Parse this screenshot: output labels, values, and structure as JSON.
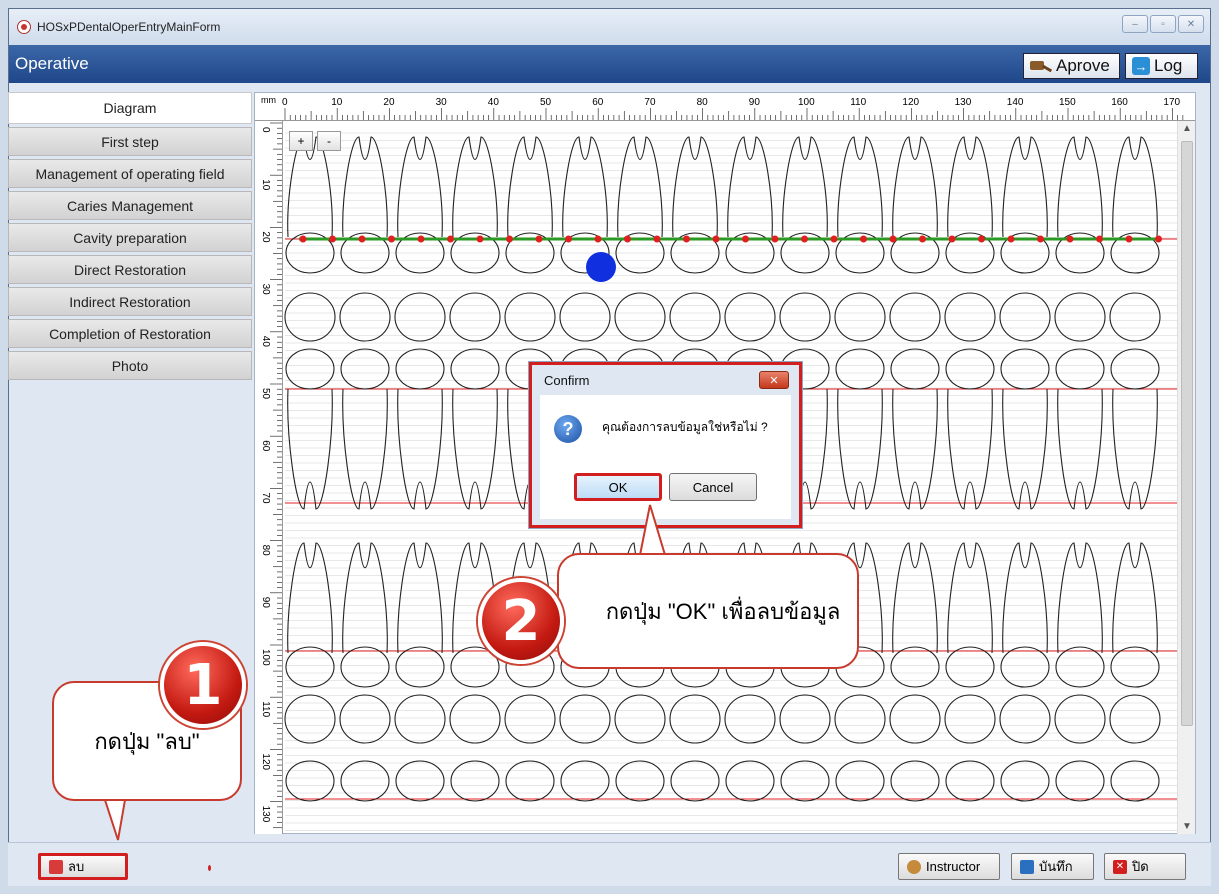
{
  "window": {
    "title": "HOSxPDentalOperEntryMainForm",
    "controls": [
      "–",
      "▫",
      "✕"
    ]
  },
  "header": {
    "title": "Operative",
    "aprove_label": "Aprove",
    "log_label": "Log"
  },
  "sidebar": {
    "items": [
      {
        "label": "Diagram",
        "active": true
      },
      {
        "label": "First step"
      },
      {
        "label": "Management of operating field"
      },
      {
        "label": "Caries Management"
      },
      {
        "label": "Cavity preparation"
      },
      {
        "label": "Direct Restoration"
      },
      {
        "label": "Indirect Restoration"
      },
      {
        "label": "Completion of Restoration"
      },
      {
        "label": "Photo"
      }
    ]
  },
  "ruler": {
    "unit": "mm",
    "top_labels": [
      "0",
      "10",
      "20",
      "30",
      "40",
      "50",
      "60",
      "70",
      "80",
      "90",
      "100",
      "110",
      "120",
      "130",
      "140",
      "150",
      "160",
      "170"
    ],
    "left_labels": [
      "0",
      "10",
      "20",
      "30",
      "40",
      "50",
      "60",
      "70",
      "80",
      "90",
      "100",
      "110",
      "120",
      "130"
    ]
  },
  "zoom": {
    "plus": "+",
    "minus": "-"
  },
  "dialog": {
    "title": "Confirm",
    "message": "คุณต้องการลบข้อมูลใช่หรือไม่ ?",
    "ok_label": "OK",
    "cancel_label": "Cancel",
    "icon": "?"
  },
  "footer": {
    "delete_label": "ลบ",
    "instructor_label": "Instructor",
    "save_label": "บันทึก",
    "close_label": "ปิด"
  },
  "annotations": {
    "step1_number": "1",
    "step1_text": "กดปุ่ม \"ลบ\"",
    "step2_number": "2",
    "step2_text": "กดปุ่ม \"OK\" เพื่อลบข้อมูล"
  },
  "colors": {
    "header_blue": "#1f4789",
    "highlight_red": "#d21e1e",
    "guide_line_red": "#e02020",
    "guide_line_green": "#2a9a22",
    "marker_blue": "#1030e0"
  }
}
